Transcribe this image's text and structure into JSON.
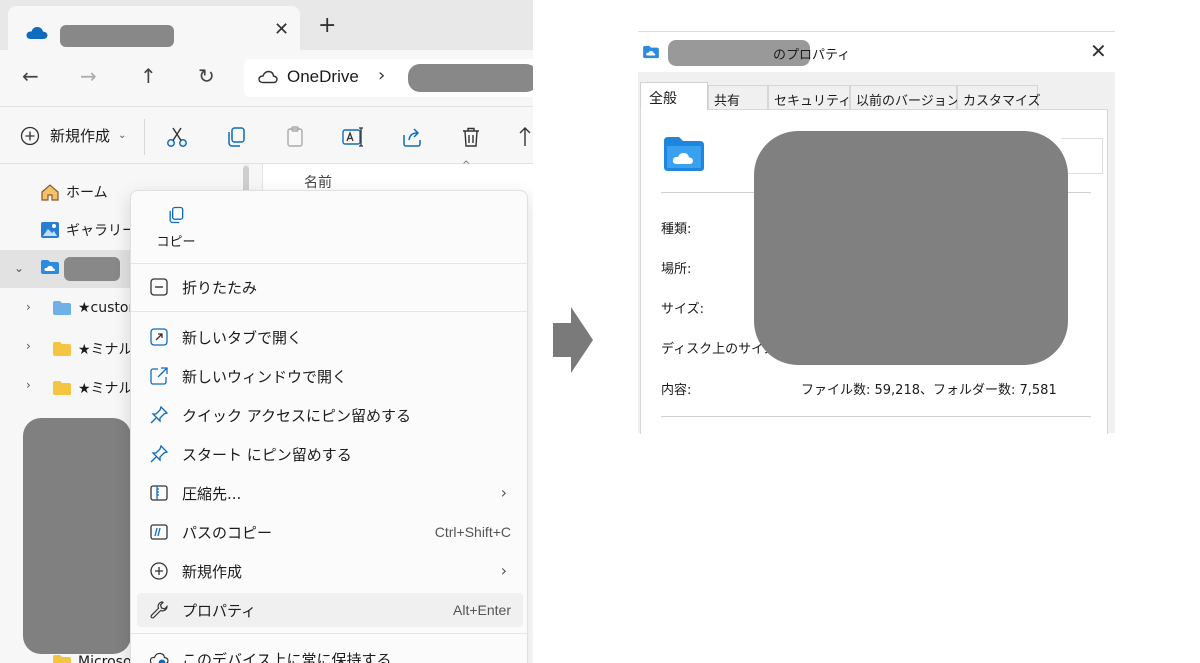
{
  "explorer": {
    "tab": {
      "close_glyph": "✕",
      "new_glyph": "+"
    },
    "nav": {
      "back": "←",
      "forward": "→",
      "up": "↑",
      "refresh": "↻"
    },
    "address": {
      "root": "OneDrive",
      "separator": "›"
    },
    "toolbar": {
      "new_label": "新規作成",
      "new_chevron": "⌄",
      "icons": [
        "cut-icon",
        "copy-icon",
        "paste-icon",
        "rename-icon",
        "share-icon",
        "delete-icon",
        "sort-icon"
      ]
    },
    "column_header": "名前",
    "tree": [
      {
        "label": "ホーム",
        "icon": "home-icon"
      },
      {
        "label": "ギャラリー",
        "icon": "gallery-icon"
      },
      {
        "label": "",
        "icon": "onedrive-folder-icon"
      },
      {
        "label": "★custom",
        "icon": "folder-icon"
      },
      {
        "label": "★ミナルキ",
        "icon": "folder-icon"
      },
      {
        "label": "★ミナルキ",
        "icon": "folder-icon"
      },
      {
        "label": "Microsof",
        "icon": "folder-icon"
      }
    ],
    "context_menu": {
      "top_action": "コピー",
      "items": [
        {
          "label": "折りたたみ",
          "icon": "collapse-icon",
          "shortcut": "",
          "submenu": false
        },
        {
          "label": "新しいタブで開く",
          "icon": "open-new-tab-icon",
          "shortcut": "",
          "submenu": false
        },
        {
          "label": "新しいウィンドウで開く",
          "icon": "open-new-window-icon",
          "shortcut": "",
          "submenu": false
        },
        {
          "label": "クイック アクセスにピン留めする",
          "icon": "pin-icon",
          "shortcut": "",
          "submenu": false
        },
        {
          "label": "スタート にピン留めする",
          "icon": "pin-icon",
          "shortcut": "",
          "submenu": false
        },
        {
          "label": "圧縮先...",
          "icon": "zip-icon",
          "shortcut": "",
          "submenu": true
        },
        {
          "label": "パスのコピー",
          "icon": "copy-path-icon",
          "shortcut": "Ctrl+Shift+C",
          "submenu": false
        },
        {
          "label": "新規作成",
          "icon": "new-icon",
          "shortcut": "",
          "submenu": true
        },
        {
          "label": "プロパティ",
          "icon": "wrench-icon",
          "shortcut": "Alt+Enter",
          "submenu": false
        },
        {
          "label": "このデバイス上に常に保持する",
          "icon": "keep-on-device-icon",
          "shortcut": "",
          "submenu": false
        }
      ],
      "submenu_glyph": "›",
      "highlighted_index": 8
    }
  },
  "properties": {
    "title_suffix": "のプロパティ",
    "close_glyph": "✕",
    "tabs": [
      "全般",
      "共有",
      "セキュリティ",
      "以前のバージョン",
      "カスタマイズ"
    ],
    "active_tab": 0,
    "fields": [
      {
        "label": "種類:",
        "value": ""
      },
      {
        "label": "場所:",
        "value": ""
      },
      {
        "label": "サイズ:",
        "value": ""
      },
      {
        "label": "ディスク上のサイズ:",
        "value": ""
      },
      {
        "label": "内容:",
        "value": "ファイル数: 59,218、フォルダー数: 7,581"
      }
    ]
  },
  "colors": {
    "accent": "#0f6cbd",
    "folder_yellow": "#f4c542",
    "folder_blue": "#6fb0e8",
    "redaction": "#808080"
  }
}
